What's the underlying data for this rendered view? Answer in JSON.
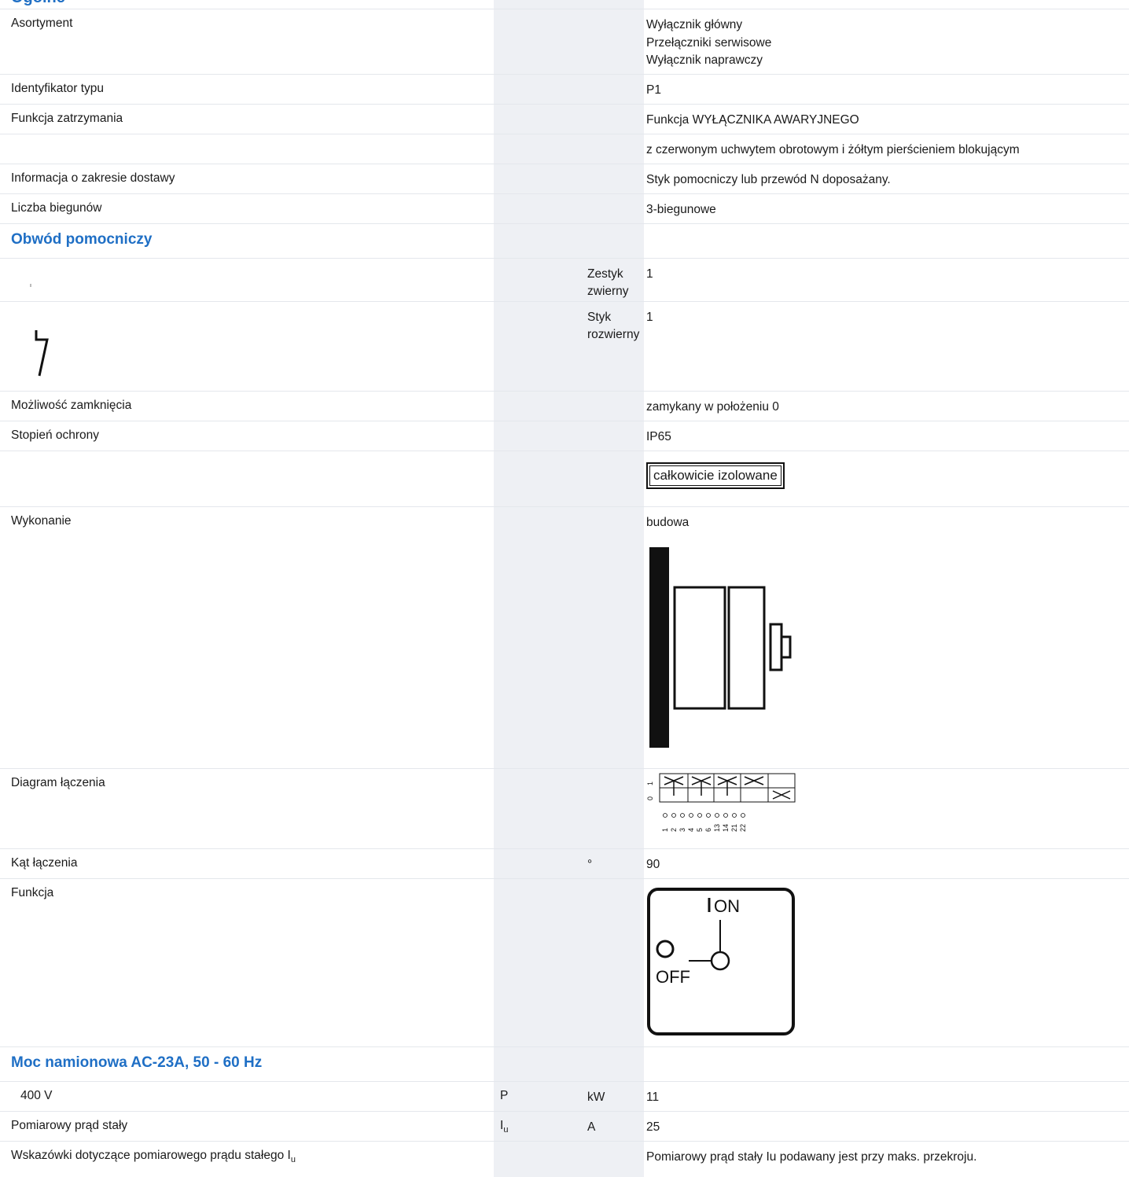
{
  "cut_heading": "Ogólne",
  "rows": {
    "asortyment": {
      "label": "Asortyment",
      "values": [
        "Wyłącznik główny",
        "Przełączniki serwisowe",
        "Wyłącznik naprawczy"
      ]
    },
    "identyfikator": {
      "label": "Identyfikator typu",
      "value": "P1"
    },
    "funkcja_zatrzymania": {
      "label": "Funkcja zatrzymania",
      "value": "Funkcja WYŁĄCZNIKA AWARYJNEGO"
    },
    "uchwyt": {
      "value": "z czerwonym uchwytem obrotowym i żółtym pierścieniem blokującym"
    },
    "zakres_dostawy": {
      "label": "Informacja o zakresie dostawy",
      "value": "Styk pomocniczy lub przewód N doposażany."
    },
    "bieguny": {
      "label": "Liczba biegunów",
      "value": "3-biegunowe"
    },
    "obwod_heading": "Obwód pomocniczy",
    "zestyk_zwierny": {
      "unit_line1": "Zestyk",
      "unit_line2": "zwierny",
      "value": "1"
    },
    "styk_rozwierny": {
      "unit_line1": "Styk",
      "unit_line2": "rozwierny",
      "value": "1"
    },
    "zamkniecie": {
      "label": "Możliwość zamknięcia",
      "value": "zamykany w położeniu 0"
    },
    "ochrona": {
      "label": "Stopień ochrony",
      "value": "IP65"
    },
    "izolacja": {
      "badge": "całkowicie izolowane"
    },
    "wykonanie": {
      "label": "Wykonanie",
      "value": "budowa"
    },
    "diagram": {
      "label": "Diagram łączenia",
      "positions": [
        "1",
        "0"
      ],
      "terminals": [
        "1",
        "2",
        "3",
        "4",
        "5",
        "6",
        "13",
        "14",
        "21",
        "22"
      ]
    },
    "kat": {
      "label": "Kąt łączenia",
      "unit": "°",
      "value": "90"
    },
    "funkcja": {
      "label": "Funkcja",
      "on_label": "ON",
      "off_label": "OFF"
    },
    "moc_heading": "Moc namionowa AC-23A, 50 - 60 Hz",
    "moc_400": {
      "label": "400 V",
      "symbol": "P",
      "unit": "kW",
      "value": "11"
    },
    "prad": {
      "label": "Pomiarowy prąd stały",
      "symbol": "I",
      "symbol_sub": "u",
      "unit": "A",
      "value": "25"
    },
    "wskazowki": {
      "label": "Wskazówki dotyczące pomiarowego prądu stałego I",
      "label_sub": "u",
      "value": "Pomiarowy prąd stały Iu podawany jest przy maks. przekroju."
    }
  }
}
